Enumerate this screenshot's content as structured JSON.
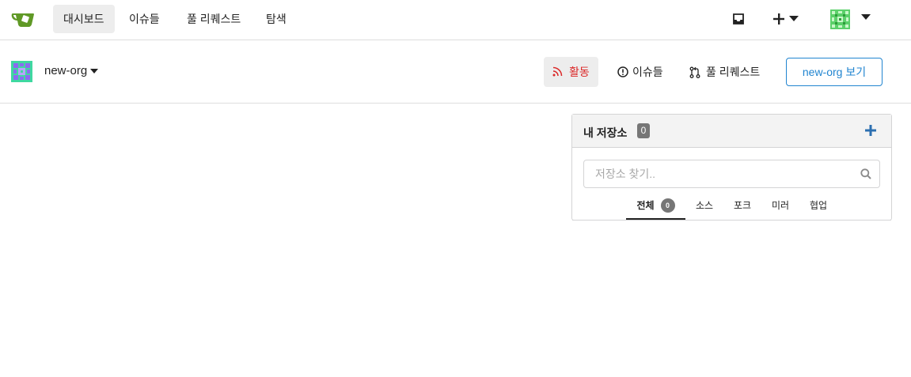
{
  "topnav": {
    "logo_icon": "gitea-teacup-logo",
    "items": [
      {
        "label": "대시보드",
        "active": true
      },
      {
        "label": "이슈들",
        "active": false
      },
      {
        "label": "풀 리퀘스트",
        "active": false
      },
      {
        "label": "탐색",
        "active": false
      }
    ],
    "inbox_icon": "inbox-icon",
    "create_icon": "plus-icon",
    "avatar_icon": "user-avatar"
  },
  "org": {
    "name": "new-org",
    "tabs": [
      {
        "label": "활동",
        "icon": "rss-icon",
        "active": true
      },
      {
        "label": "이슈들",
        "icon": "issue-opened-icon",
        "active": false
      },
      {
        "label": "풀 리퀘스트",
        "icon": "pull-request-icon",
        "active": false
      }
    ],
    "view_button": "new-org 보기"
  },
  "repos": {
    "title": "내 저장소",
    "count": "0",
    "search_placeholder": "저장소 찾기..",
    "search_value": "",
    "filters": [
      {
        "label": "전체",
        "badge": "0",
        "active": true
      },
      {
        "label": "소스",
        "active": false
      },
      {
        "label": "포크",
        "active": false
      },
      {
        "label": "미러",
        "active": false
      },
      {
        "label": "협업",
        "active": false
      }
    ]
  },
  "colors": {
    "accent_blue": "#2185d0",
    "active_red": "#db2828",
    "logo_green": "#609926",
    "badge_grey": "#767676"
  }
}
